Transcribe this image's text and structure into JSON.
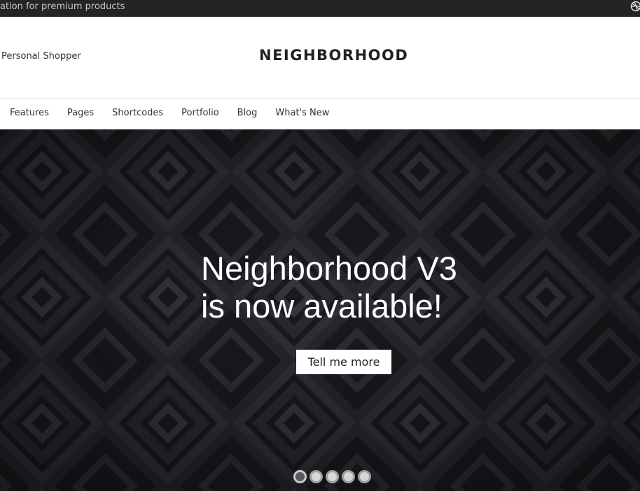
{
  "topbar": {
    "promo_text": "ation for premium products",
    "social_icon": "dribbble-icon"
  },
  "header": {
    "shopper_link": "Personal Shopper",
    "logo_text": "NEIGHBORHOOD"
  },
  "nav": {
    "items": [
      {
        "label": "Features"
      },
      {
        "label": "Pages"
      },
      {
        "label": "Shortcodes"
      },
      {
        "label": "Portfolio"
      },
      {
        "label": "Blog"
      },
      {
        "label": "What's New"
      }
    ]
  },
  "hero": {
    "headline_line1": "Neighborhood V3",
    "headline_line2": "is now available!",
    "cta_label": "Tell me more",
    "slides": {
      "count": 5,
      "active": 1
    }
  },
  "colors": {
    "topbar_bg": "#242424",
    "hero_bg": "#1c1b20",
    "text_dark": "#222222",
    "cta_bg": "#ffffff"
  }
}
